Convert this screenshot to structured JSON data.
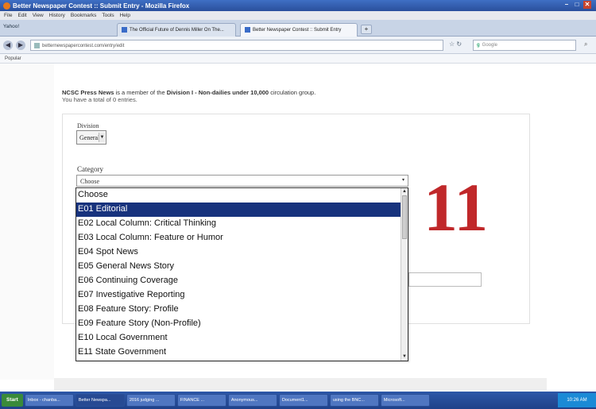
{
  "window": {
    "title": "Better Newspaper Contest :: Submit Entry - Mozilla Firefox"
  },
  "menubar": [
    "File",
    "Edit",
    "View",
    "History",
    "Bookmarks",
    "Tools",
    "Help"
  ],
  "tabbar": {
    "bookmark_label": "Yahoo!",
    "tabs": [
      {
        "label": "The Official Future of Dennis Miller On The...",
        "active": false
      },
      {
        "label": "Better Newspaper Contest :: Submit Entry",
        "active": true
      }
    ],
    "new_tab": "+"
  },
  "navbar": {
    "url": "betternewspapercontest.com/entry/edit",
    "search_placeholder": "Google"
  },
  "bookmarks_bar": {
    "label": "Popular"
  },
  "page": {
    "member_name": "NCSC Press News",
    "member_text_1": " is a member of the ",
    "division_name": "Division I - Non-dailies under 10,000",
    "member_text_2": " circulation group.",
    "entries_text": "You have a total of 0 entries.",
    "division_label": "Division",
    "division_value": "General",
    "category_label": "Category",
    "category_value": "Choose",
    "category_options": [
      "Choose",
      "E01 Editorial",
      "E02 Local Column: Critical Thinking",
      "E03 Local Column: Feature or Humor",
      "E04 Spot News",
      "E05 General News Story",
      "E06 Continuing Coverage",
      "E07 Investigative Reporting",
      "E08 Feature Story: Profile",
      "E09 Feature Story (Non-Profile)",
      "E10 Local Government",
      "E11 State Government"
    ],
    "selected_option": "E01 Editorial",
    "step_number": "11"
  },
  "taskbar": {
    "start": "Start",
    "items": [
      {
        "label": "Inbox - chanba...",
        "active": false
      },
      {
        "label": "Better Newspa...",
        "active": true
      },
      {
        "label": "2016 judging ...",
        "active": false
      },
      {
        "label": "FINANCE ...",
        "active": false
      },
      {
        "label": "Anonymous...",
        "active": false
      },
      {
        "label": "Document1...",
        "active": false
      },
      {
        "label": "using the BNC...",
        "active": false
      },
      {
        "label": "Microsoft...",
        "active": false
      }
    ],
    "clock": "10:26 AM"
  },
  "colors": {
    "accent_selection": "#17327d",
    "step_number": "#c0282a"
  }
}
